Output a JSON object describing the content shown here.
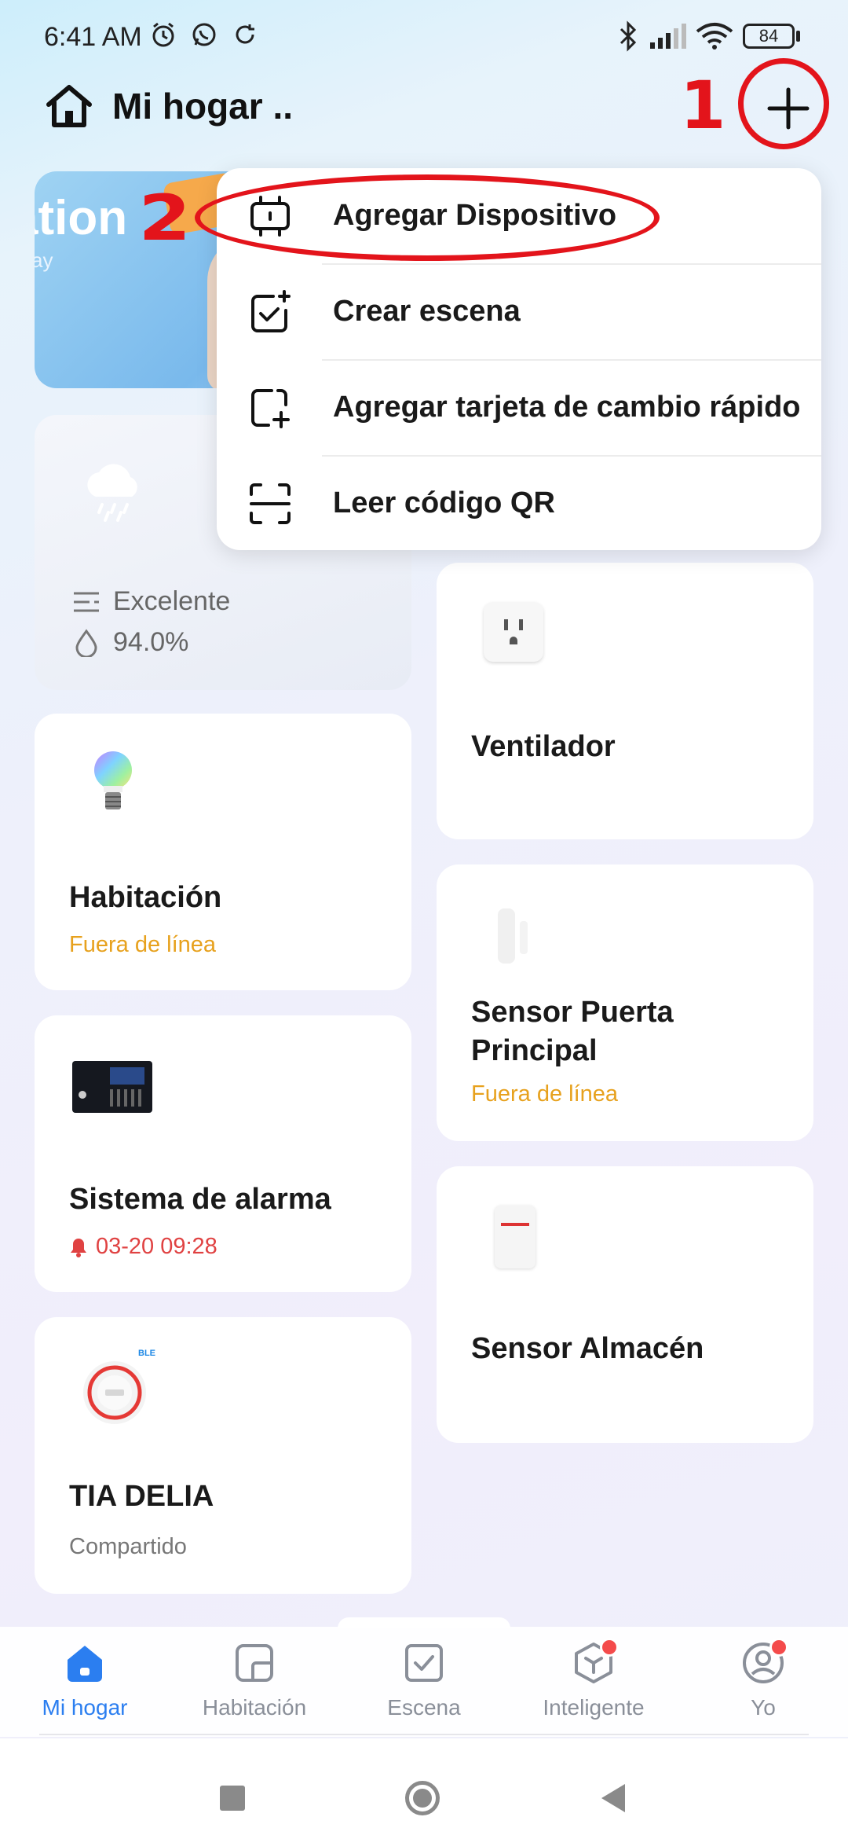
{
  "status_bar": {
    "time": "6:41 AM",
    "battery": "84"
  },
  "header": {
    "home_title": "Mi hogar ..",
    "annotation_1": "1",
    "annotation_2": "2"
  },
  "banner": {
    "text": "ation",
    "sub": "ay"
  },
  "weather": {
    "air_quality": "Excelente",
    "humidity": "94.0%"
  },
  "menu": {
    "items": [
      {
        "label": "Agregar Dispositivo",
        "icon": "add-device-icon"
      },
      {
        "label": "Crear escena",
        "icon": "create-scene-icon"
      },
      {
        "label": "Agregar tarjeta de cambio rápido",
        "icon": "add-card-icon"
      },
      {
        "label": "Leer código QR",
        "icon": "qr-scan-icon"
      }
    ]
  },
  "devices": {
    "ventilador": {
      "name": "Ventilador"
    },
    "habitacion": {
      "name": "Habitación",
      "status": "Fuera de línea"
    },
    "sensor_puerta": {
      "name": "Sensor Puerta Principal",
      "status": "Fuera de línea"
    },
    "alarma": {
      "name": "Sistema de alarma",
      "status": "03-20 09:28"
    },
    "sensor_almacen": {
      "name": "Sensor Almacén"
    },
    "tia_delia": {
      "name": "TIA DELIA",
      "status": "Compartido",
      "badge": "BLE"
    }
  },
  "bottom_nav": {
    "items": [
      {
        "label": "Mi hogar",
        "active": true
      },
      {
        "label": "Habitación",
        "active": false
      },
      {
        "label": "Escena",
        "active": false
      },
      {
        "label": "Inteligente",
        "active": false,
        "badge": true
      },
      {
        "label": "Yo",
        "active": false,
        "badge": true
      }
    ]
  },
  "colors": {
    "accent": "#2b7ef0",
    "offline": "#e7a11d",
    "alarm": "#e04242",
    "annotation": "#e3141b"
  }
}
